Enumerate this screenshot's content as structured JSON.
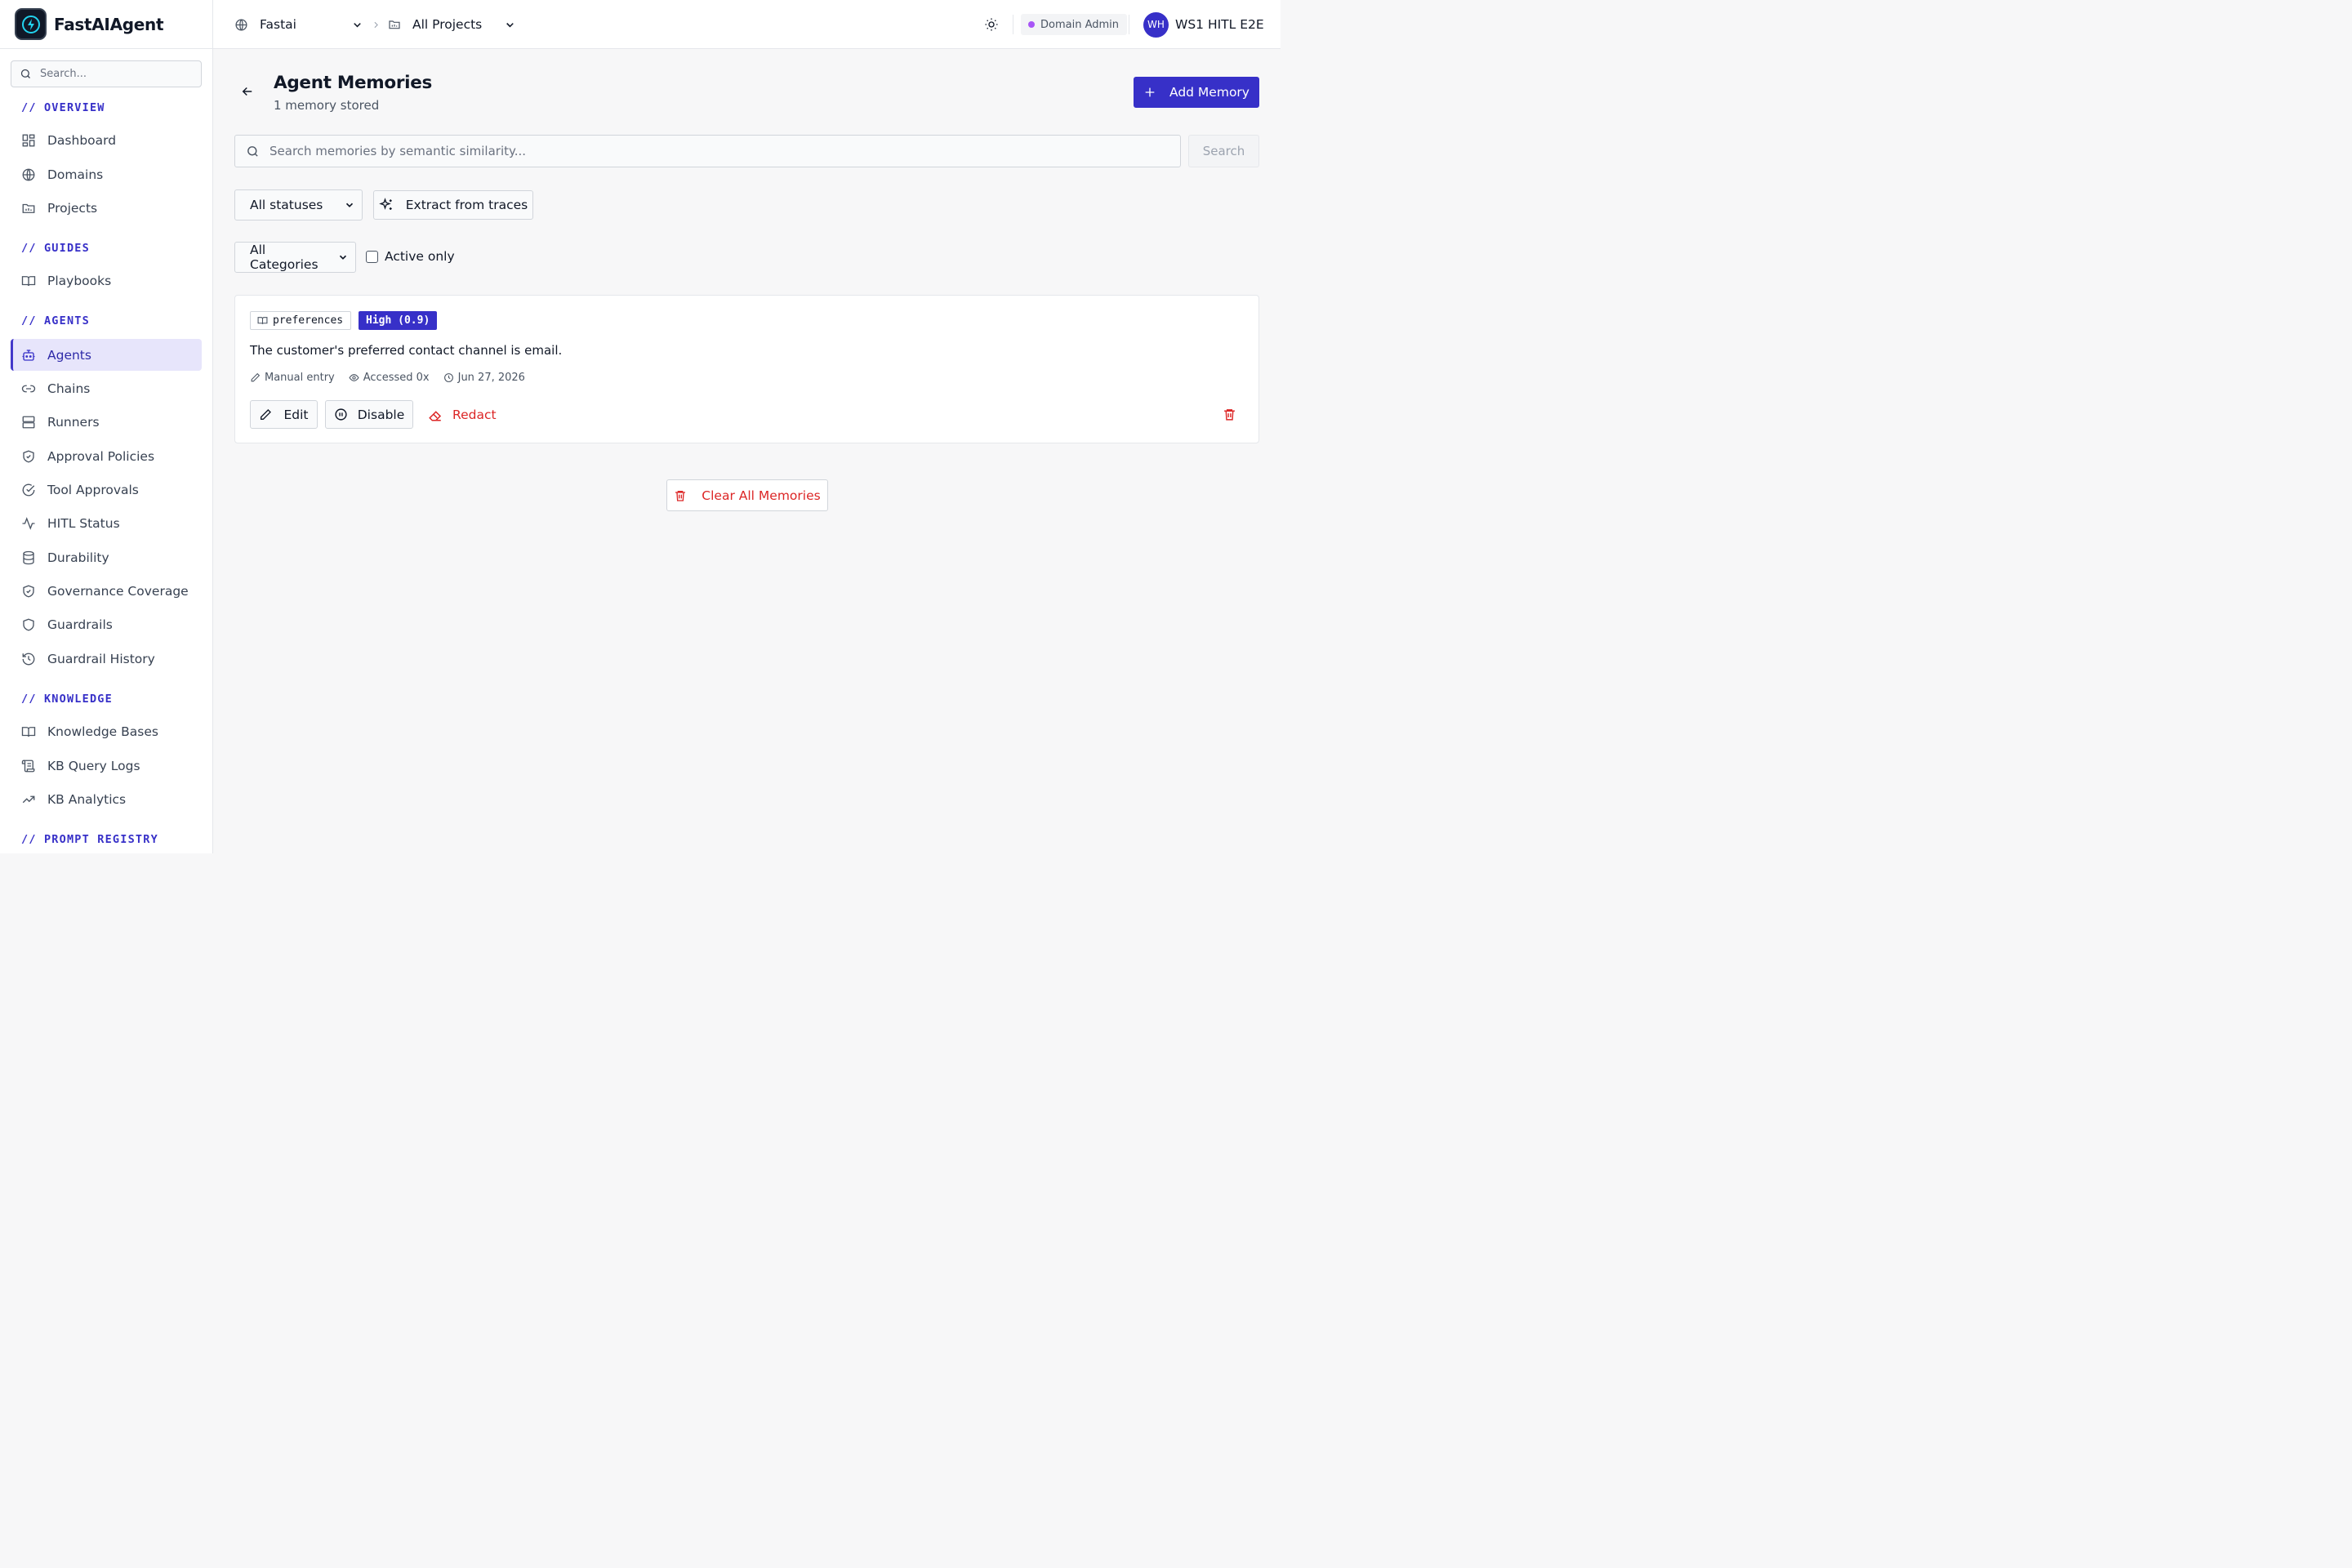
{
  "brand": {
    "name": "FastAIAgent"
  },
  "sidebar": {
    "search_placeholder": "Search...",
    "sections": {
      "overview": "// OVERVIEW",
      "guides": "// GUIDES",
      "agents": "// AGENTS",
      "knowledge": "// KNOWLEDGE",
      "prompt_registry": "// PROMPT REGISTRY"
    },
    "items": {
      "dashboard": "Dashboard",
      "domains": "Domains",
      "projects": "Projects",
      "playbooks": "Playbooks",
      "agents": "Agents",
      "chains": "Chains",
      "runners": "Runners",
      "approval_policies": "Approval Policies",
      "tool_approvals": "Tool Approvals",
      "hitl_status": "HITL Status",
      "durability": "Durability",
      "governance_coverage": "Governance Coverage",
      "guardrails": "Guardrails",
      "guardrail_history": "Guardrail History",
      "knowledge_bases": "Knowledge Bases",
      "kb_query_logs": "KB Query Logs",
      "kb_analytics": "KB Analytics"
    },
    "active_item": "Agents"
  },
  "topbar": {
    "domain": "Fastai",
    "project": "All Projects",
    "role_badge": "Domain Admin",
    "role_dot_color": "#a855f7",
    "user_initials": "WH",
    "user_name": "WS1 HITL E2E"
  },
  "page": {
    "title": "Agent Memories",
    "subtitle": "1 memory stored",
    "add_button": "Add Memory",
    "search_placeholder": "Search memories by semantic similarity...",
    "search_button": "Search",
    "status_filter": "All statuses",
    "extract_button": "Extract from traces",
    "category_filter": "All Categories",
    "active_only_label": "Active only",
    "active_only_checked": false,
    "clear_all_button": "Clear All Memories"
  },
  "memories": [
    {
      "category": "preferences",
      "importance": "High (0.9)",
      "content": "The customer's preferred contact channel is email.",
      "source": "Manual entry",
      "accessed": "Accessed 0x",
      "date": "Jun 27, 2026",
      "actions": {
        "edit": "Edit",
        "disable": "Disable",
        "redact": "Redact"
      }
    }
  ],
  "colors": {
    "accent": "#3730c8",
    "danger": "#dc2626",
    "active_nav_bg": "#e7e5fb"
  }
}
